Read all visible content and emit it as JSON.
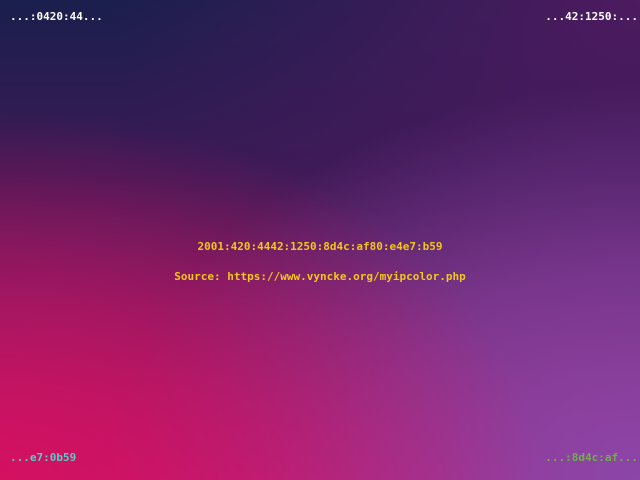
{
  "corners": {
    "top_left": "...:0420:44...",
    "top_right": "...42:1250:...",
    "bottom_left": "...e7:0b59",
    "bottom_right": "...:8d4c:af..."
  },
  "center": {
    "ip_address": "2001:420:4442:1250:8d4c:af80:e4e7:b59",
    "source_line": "Source: https://www.vyncke.org/myipcolor.php"
  },
  "colors": {
    "top_left_text": "#ffffff",
    "top_right_text": "#ffffff",
    "bottom_left_text": "#4fd0c8",
    "bottom_right_text": "#6fb04a",
    "center_text": "#f2c61e",
    "background_top_left": "#1a1f4d",
    "background_bottom_left": "#d41060",
    "background_bottom_right": "#8a46a8",
    "background_top_right": "#4e1a60"
  }
}
